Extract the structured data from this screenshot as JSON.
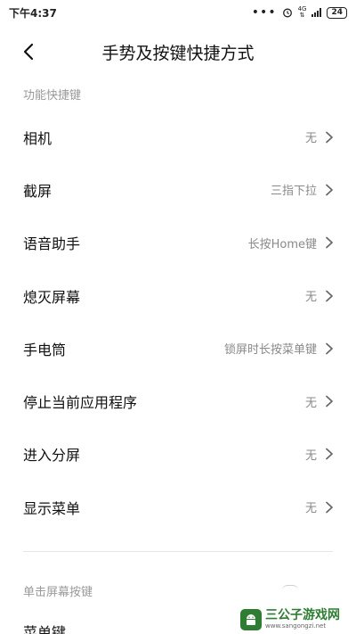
{
  "status_bar": {
    "time": "下午4:37",
    "network": "4G",
    "battery": "24"
  },
  "header": {
    "title": "手势及按键快捷方式"
  },
  "sections": {
    "function_shortcuts": {
      "label": "功能快捷键",
      "items": [
        {
          "label": "相机",
          "value": "无"
        },
        {
          "label": "截屏",
          "value": "三指下拉"
        },
        {
          "label": "语音助手",
          "value": "长按Home键"
        },
        {
          "label": "熄灭屏幕",
          "value": "无"
        },
        {
          "label": "手电筒",
          "value": "锁屏时长按菜单键"
        },
        {
          "label": "停止当前应用程序",
          "value": "无"
        },
        {
          "label": "进入分屏",
          "value": "无"
        },
        {
          "label": "显示菜单",
          "value": "无"
        }
      ]
    },
    "single_tap_buttons": {
      "label": "单击屏幕按键",
      "partial_item": "菜单键"
    }
  },
  "watermark": {
    "name": "三公子游戏网",
    "url": "www.sangongzi.net"
  },
  "colors": {
    "section_label": "#9a9a9a",
    "value_text": "#8a8a8a",
    "watermark_green": "#2e7d32"
  }
}
